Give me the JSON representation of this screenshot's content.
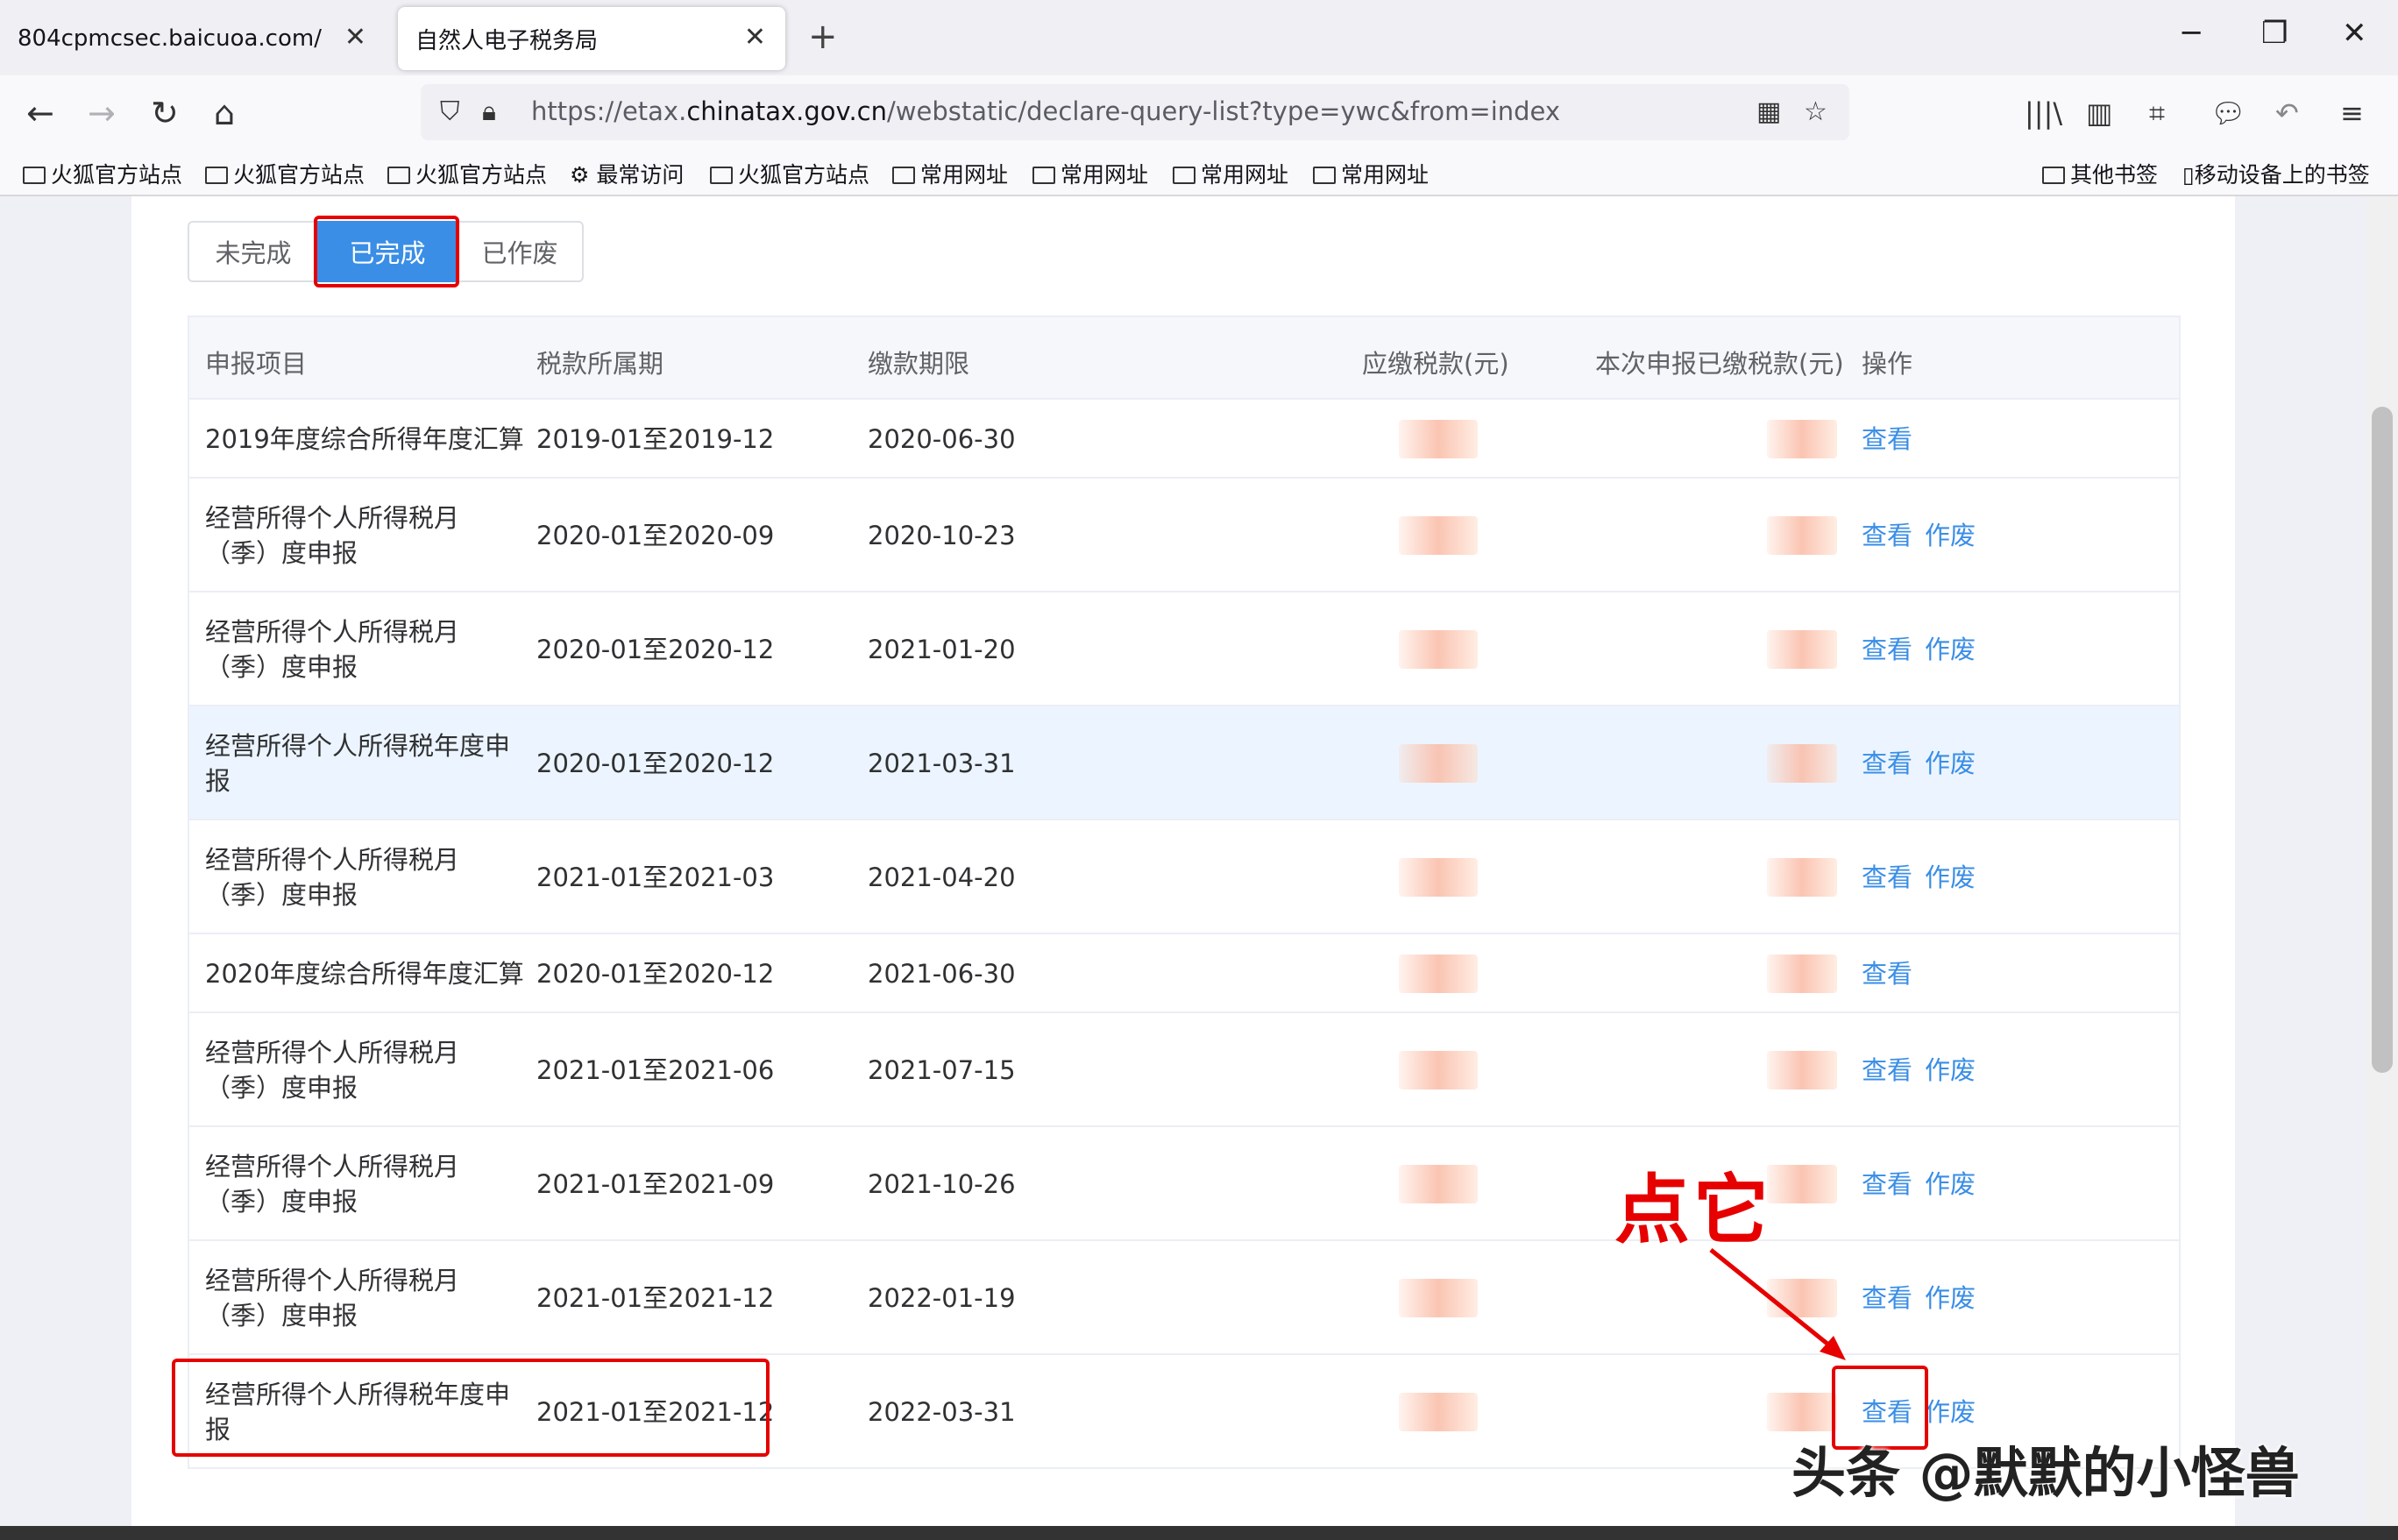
{
  "tabs": [
    {
      "label": "804cpmcsec.baicuoa.com/"
    },
    {
      "label": "自然人电子税务局"
    }
  ],
  "url": {
    "prefix": "https://etax.",
    "domain": "chinatax.gov.cn",
    "suffix": "/webstatic/declare-query-list?type=ywc&from=index"
  },
  "bookmarks": [
    "火狐官方站点",
    "火狐官方站点",
    "火狐官方站点",
    "最常访问",
    "火狐官方站点",
    "常用网址",
    "常用网址",
    "常用网址",
    "常用网址"
  ],
  "bookmarks_right": [
    "其他书签",
    "移动设备上的书签"
  ],
  "segments": [
    "未完成",
    "已完成",
    "已作废"
  ],
  "active_segment": "已完成",
  "columns": [
    "申报项目",
    "税款所属期",
    "缴款期限",
    "应缴税款(元)",
    "本次申报已缴税款(元)",
    "操作"
  ],
  "rows": [
    {
      "item": [
        "2019年度综合所得年度汇算"
      ],
      "period": "2019-01至2019-12",
      "deadline": "2020-06-30",
      "actions": [
        "查看"
      ]
    },
    {
      "item": [
        "经营所得个人所得税月",
        "（季）度申报"
      ],
      "period": "2020-01至2020-09",
      "deadline": "2020-10-23",
      "actions": [
        "查看",
        "作废"
      ]
    },
    {
      "item": [
        "经营所得个人所得税月",
        "（季）度申报"
      ],
      "period": "2020-01至2020-12",
      "deadline": "2021-01-20",
      "actions": [
        "查看",
        "作废"
      ]
    },
    {
      "item": [
        "经营所得个人所得税年度申",
        "报"
      ],
      "period": "2020-01至2020-12",
      "deadline": "2021-03-31",
      "actions": [
        "查看",
        "作废"
      ]
    },
    {
      "item": [
        "经营所得个人所得税月",
        "（季）度申报"
      ],
      "period": "2021-01至2021-03",
      "deadline": "2021-04-20",
      "actions": [
        "查看",
        "作废"
      ]
    },
    {
      "item": [
        "2020年度综合所得年度汇算"
      ],
      "period": "2020-01至2020-12",
      "deadline": "2021-06-30",
      "actions": [
        "查看"
      ]
    },
    {
      "item": [
        "经营所得个人所得税月",
        "（季）度申报"
      ],
      "period": "2021-01至2021-06",
      "deadline": "2021-07-15",
      "actions": [
        "查看",
        "作废"
      ]
    },
    {
      "item": [
        "经营所得个人所得税月",
        "（季）度申报"
      ],
      "period": "2021-01至2021-09",
      "deadline": "2021-10-26",
      "actions": [
        "查看",
        "作废"
      ]
    },
    {
      "item": [
        "经营所得个人所得税月",
        "（季）度申报"
      ],
      "period": "2021-01至2021-12",
      "deadline": "2022-01-19",
      "actions": [
        "查看",
        "作废"
      ]
    },
    {
      "item": [
        "经营所得个人所得税年度申",
        "报"
      ],
      "period": "2021-01至2021-12",
      "deadline": "2022-03-31",
      "actions": [
        "查看",
        "作废"
      ]
    }
  ],
  "annotation": "点它",
  "watermark": "头条 @默默的小怪兽",
  "colors": {
    "accent": "#3a8ee6",
    "highlight": "#e60000"
  }
}
